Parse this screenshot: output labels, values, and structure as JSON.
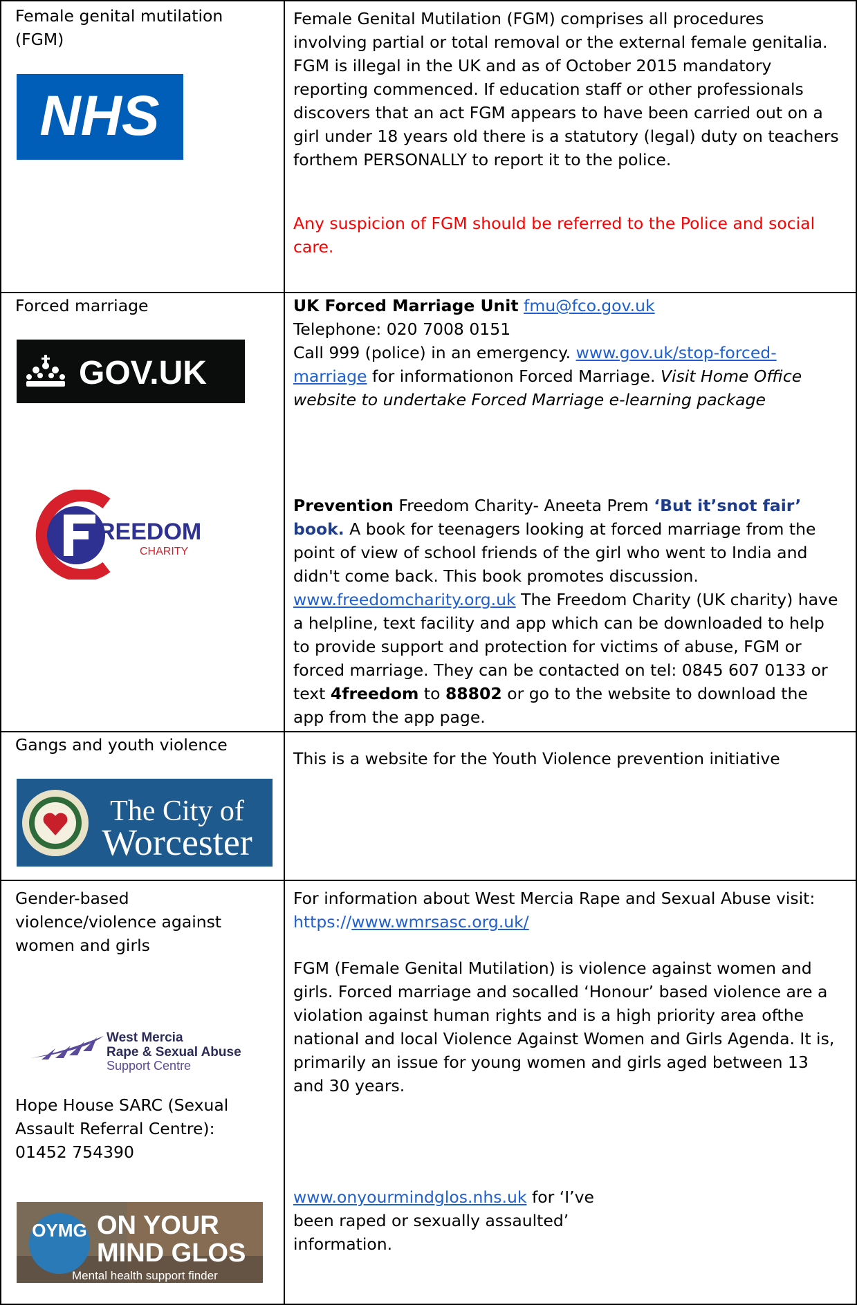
{
  "rows": [
    {
      "topic": "Female genital mutilation (FGM)",
      "logo": "NHS",
      "body": "Female Genital Mutilation (FGM) comprises all procedures involving partial or total removal or the external female genitalia. FGM is illegal in the UK and as of October 2015 mandatory reporting commenced. If education staff or other professionals discovers that an act FGM appears to have been carried out on a girl under 18 years old there is a statutory (legal) duty on teachers forthem PERSONALLY to report it to the police.",
      "warning": "Any suspicion of FGM should be referred to the Police and social care."
    },
    {
      "topic": "Forced marriage",
      "logo_govuk": "GOV.UK",
      "unit_label": "UK Forced Marriage Unit",
      "unit_email": "fmu@fco.gov.uk",
      "telephone": "Telephone: 020 7008 0151",
      "emergency_prefix": "Call 999 (police) in an emergency.",
      "govuk_link": "www.gov.uk/stop-forced-marriage",
      "info_suffix": "for informationon Forced Marriage.",
      "elearning": "Visit Home Office website to undertake Forced Marriage e-learning package",
      "freedom_logo_main": "REEDOM",
      "freedom_logo_sub": "CHARITY",
      "prevention_label": "Prevention",
      "prevention_text": "Freedom Charity- Aneeta Prem",
      "book_title": "‘But it’snot fair’ book.",
      "book_desc": "A book for teenagers looking at forced marriage from the point of view of school friends of the girl who went to India and didn't come back. This book promotes discussion.",
      "freedom_link": "www.freedomcharity.org.uk",
      "freedom_text": "The Freedom Charity (UK charity) have a helpline, text facility and app which can be downloaded to help to provide support and protection for victims of abuse, FGM or forced marriage. They can be contacted on tel: 0845 607 0133 or text",
      "text_code": "4freedom",
      "text_to": "to",
      "text_number": "88802",
      "text_end": "or go to the website to download the app from the app page."
    },
    {
      "topic": "Gangs and youth violence",
      "logo_line1": "The City of",
      "logo_line2": "Worcester",
      "body": "This is a website for the Youth Violence prevention initiative"
    },
    {
      "topic": "Gender-based violence/violence against women and girls",
      "wm_logo_line1": "West Mercia",
      "wm_logo_line2": "Rape & Sexual Abuse",
      "wm_logo_line3": "Support Centre",
      "sarc_text": "Hope House SARC (Sexual Assault Referral Centre): 01452 754390",
      "oymg_mark": "OYMG",
      "oymg_line1": "ON YOUR",
      "oymg_line2": "MIND GLOS",
      "oymg_tagline": "Mental health support finder",
      "wmrsasc_prefix": "For information about West Mercia Rape and Sexual Abuse visit:",
      "wmrsasc_scheme": "https://",
      "wmrsasc_link": "www.wmrsasc.org.uk/",
      "fgm_text": "FGM (Female Genital Mutilation) is violence against women and girls. Forced marriage and socalled ‘Honour’ based violence are a violation against human rights and is a high priority area ofthe national and local Violence Against Women and Girls Agenda. It is, primarily an issue for young women and girls aged between 13 and 30 years.",
      "oymg_link": "www.onyourmindglos.nhs.uk",
      "oymg_info": "for ‘I’ve been raped or sexually assaulted’ information."
    }
  ],
  "colors": {
    "nhs_blue": "#005eb8",
    "govuk_black": "#0b0c0c",
    "link_blue": "#1f5fd1",
    "warning_red": "#ff0000",
    "freedom_red": "#d6202b",
    "freedom_navy": "#2e3192",
    "worcester_blue": "#1f5a8e"
  }
}
